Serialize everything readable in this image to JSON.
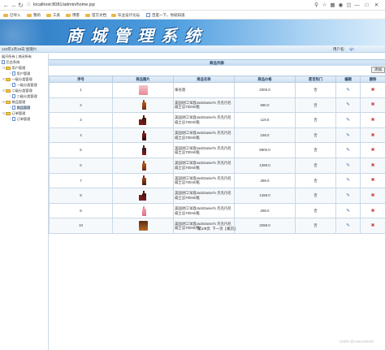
{
  "browser": {
    "url": "localhost:8081/admin/home.jsp",
    "bookmarks": [
      "已导入",
      "我的",
      "工具",
      "博客",
      "官方文档",
      "毕业设计论坛",
      "百度一下，你就知道"
    ]
  },
  "banner": {
    "title": "商城管理系统"
  },
  "infobar": {
    "date": "123年1月18日 星期六",
    "user_label": "用户名:",
    "username": "cjh"
  },
  "sidebar": {
    "expand_all": "展开所有",
    "separator": "|",
    "collapse_all": "关闭所有",
    "root": "后台系统",
    "tree": [
      {
        "label": "用户管理",
        "level": 1,
        "type": "folder"
      },
      {
        "label": "用户管理",
        "level": 2,
        "type": "page"
      },
      {
        "label": "一级分类管理",
        "level": 1,
        "type": "folder"
      },
      {
        "label": "一级分类管理",
        "level": 2,
        "type": "page"
      },
      {
        "label": "二级分类管理",
        "level": 1,
        "type": "folder"
      },
      {
        "label": "二级分类管理",
        "level": 2,
        "type": "page"
      },
      {
        "label": "商品管理",
        "level": 1,
        "type": "folder"
      },
      {
        "label": "商品管理",
        "level": 2,
        "type": "page",
        "active": true
      },
      {
        "label": "订单管理",
        "level": 1,
        "type": "folder"
      },
      {
        "label": "订单管理",
        "level": 2,
        "type": "page"
      }
    ]
  },
  "main": {
    "list_title": "商品列表",
    "add_button": "添加",
    "columns": [
      "序号",
      "商品图片",
      "商品名称",
      "商品价格",
      "是否热门",
      "编辑",
      "删除"
    ],
    "rows": [
      {
        "no": "1",
        "name": "果谷酒",
        "price": "2000.0",
        "hot": "否",
        "thumb": "box-pink"
      },
      {
        "no": "2",
        "name": "美国进口洋酒JackDaniel's 杰克丹尼威士忌700ml/瓶",
        "price": "690.0",
        "hot": "否",
        "thumb": "bottle-amber"
      },
      {
        "no": "3",
        "name": "美国进口洋酒JackDaniel's 杰克丹尼威士忌700ml/瓶",
        "price": "119.0",
        "hot": "否",
        "thumb": "bottles-dark"
      },
      {
        "no": "4",
        "name": "美国进口洋酒JackDaniel's 杰克丹尼威士忌700ml/瓶",
        "price": "158.0",
        "hot": "否",
        "thumb": "bottle-red"
      },
      {
        "no": "5",
        "name": "美国进口洋酒JackDaniel's 杰克丹尼威士忌700ml/瓶",
        "price": "9900.0",
        "hot": "否",
        "thumb": "bottle-dark"
      },
      {
        "no": "6",
        "name": "美国进口洋酒JackDaniel's 杰克丹尼威士忌700ml/瓶",
        "price": "1299.0",
        "hot": "否",
        "thumb": "bottle-amber"
      },
      {
        "no": "7",
        "name": "美国进口洋酒JackDaniel's 杰克丹尼威士忌700ml/瓶",
        "price": "399.0",
        "hot": "否",
        "thumb": "bottle-brown"
      },
      {
        "no": "8",
        "name": "美国进口洋酒JackDaniel's 杰克丹尼威士忌700ml/瓶",
        "price": "1299.0",
        "hot": "否",
        "thumb": "bottles-dark"
      },
      {
        "no": "9",
        "name": "美国进口洋酒JackDaniel's 杰克丹尼威士忌700ml/瓶",
        "price": "299.0",
        "hot": "否",
        "thumb": "bottle-pink"
      },
      {
        "no": "10",
        "name": "美国进口洋酒JackDaniel's 杰克丹尼威士忌700ml/瓶",
        "price": "3299.0",
        "hot": "否",
        "thumb": "box-dark"
      }
    ],
    "pager": {
      "page_text": "第1/8页",
      "next": "下一页",
      "last": "尾页",
      "open_bracket": "[",
      "close_bracket": "]"
    }
  },
  "watermark": "CSDN @cotoozoi2022",
  "colors": {
    "banner_start": "#2d7bc4",
    "banner_end": "#d8ecfb",
    "header_bg": "#cfe1f3",
    "link": "#1a5fb4",
    "delete": "#d14a4a"
  },
  "thumb_colors": {
    "box-pink": [
      "#f2c6c9",
      "#e88a92"
    ],
    "bottle-amber": [
      "#b85a1c",
      "#6b2b0c"
    ],
    "bottles-dark": [
      "#3a1a10",
      "#7a1b1b"
    ],
    "bottle-red": [
      "#8a1a1a",
      "#2a0b0b"
    ],
    "bottle-dark": [
      "#2a2020",
      "#8a1a1a"
    ],
    "bottle-brown": [
      "#9a4a1c",
      "#4a1c08"
    ],
    "bottle-pink": [
      "#f2a0b0",
      "#d86a86"
    ],
    "box-dark": [
      "#5a2a10",
      "#b56a2a"
    ]
  }
}
